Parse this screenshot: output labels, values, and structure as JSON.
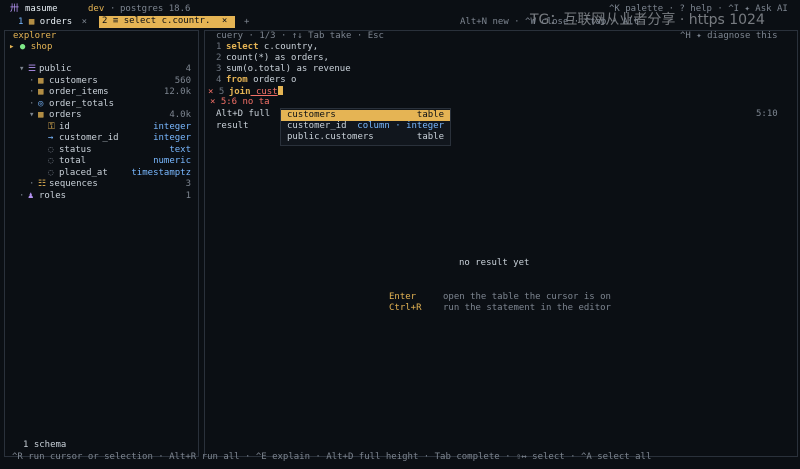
{
  "topbar": {
    "app_glyph": "卅",
    "app_name": "masume",
    "env": "dev",
    "separator": "·",
    "server": "postgres 18.6",
    "hints": "^K palette · ? help · ^I ✦ Ask AI",
    "watermark": "TG：互联网从业者分享 · https 1024"
  },
  "tabs": [
    {
      "num": "1",
      "label": "orders",
      "close": "×"
    },
    {
      "num": "2",
      "label": "select c.countr.",
      "close": "×"
    }
  ],
  "tab_add": "+",
  "tab_hint": "Alt+N new · ^W close · ^tab · Alt+1 go tab",
  "sidebar": {
    "title": "explorer",
    "connection": "shop",
    "tree": [
      {
        "indent": 1,
        "arrow": "▾",
        "icon": "database-icon",
        "glyph": "☰",
        "label": "public",
        "value": "4"
      },
      {
        "indent": 2,
        "arrow": "·",
        "icon": "table-icon",
        "glyph": "▦",
        "label": "customers",
        "value": "560"
      },
      {
        "indent": 2,
        "arrow": "·",
        "icon": "table-icon",
        "glyph": "▦",
        "label": "order_items",
        "value": "12.0k"
      },
      {
        "indent": 2,
        "arrow": "·",
        "icon": "view-icon",
        "glyph": "◎",
        "label": "order_totals",
        "value": ""
      },
      {
        "indent": 2,
        "arrow": "▾",
        "icon": "table-icon",
        "glyph": "▦",
        "label": "orders",
        "value": "4.0k"
      },
      {
        "indent": 3,
        "arrow": "",
        "icon": "key-icon",
        "glyph": "⚿",
        "label": "id",
        "value": "integer"
      },
      {
        "indent": 3,
        "arrow": "",
        "icon": "foreign-key-icon",
        "glyph": "→",
        "label": "customer_id",
        "value": "integer"
      },
      {
        "indent": 3,
        "arrow": "",
        "icon": "column-icon",
        "glyph": "◌",
        "label": "status",
        "value": "text"
      },
      {
        "indent": 3,
        "arrow": "",
        "icon": "column-icon",
        "glyph": "◌",
        "label": "total",
        "value": "numeric"
      },
      {
        "indent": 3,
        "arrow": "",
        "icon": "column-icon",
        "glyph": "◌",
        "label": "placed_at",
        "value": "timestamptz"
      },
      {
        "indent": 2,
        "arrow": "·",
        "icon": "sequence-icon",
        "glyph": "☷",
        "label": "sequences",
        "value": "3"
      },
      {
        "indent": 1,
        "arrow": "·",
        "icon": "roles-icon",
        "glyph": "♟",
        "label": "roles",
        "value": "1"
      }
    ],
    "footer": "1 schema"
  },
  "query": {
    "header": "cuery · 1/3 · ↑↓ Tab take · Esc",
    "right_hint": "^H ✦ diagnose this",
    "lines": [
      {
        "n": "1",
        "kw": "select",
        "rest": " c.country,"
      },
      {
        "n": "2",
        "kw": "",
        "rest": "count(*) as orders,"
      },
      {
        "n": "3",
        "kw": "",
        "rest": "sum(o.total) as revenue"
      },
      {
        "n": "4",
        "kw": "from",
        "rest": " orders o"
      },
      {
        "n": "5",
        "kw": "join",
        "rest": " cust"
      }
    ],
    "error_line": "× 5:6  no ta",
    "options_hint": "Alt+D full",
    "position": "5:10",
    "result_label": "result"
  },
  "completion": [
    {
      "name": "customers",
      "kind": "table",
      "selected": true
    },
    {
      "name": "customer_id",
      "kind": "column · integer",
      "selected": false
    },
    {
      "name": "public.customers",
      "kind": "table",
      "selected": false
    }
  ],
  "result": {
    "empty": "no result yet",
    "keys": [
      {
        "key": "Enter",
        "desc": "open the table the cursor is on"
      },
      {
        "key": "Ctrl+R",
        "desc": "run the statement in the editor"
      }
    ]
  },
  "statusbar": "^R run cursor or selection · Alt+R run all · ^E explain · Alt+D full height · Tab complete · ⇧↔ select · ^A select all",
  "colors": {
    "accent": "#e5b454",
    "background": "#0b0f14",
    "type": "#79b8ff"
  }
}
